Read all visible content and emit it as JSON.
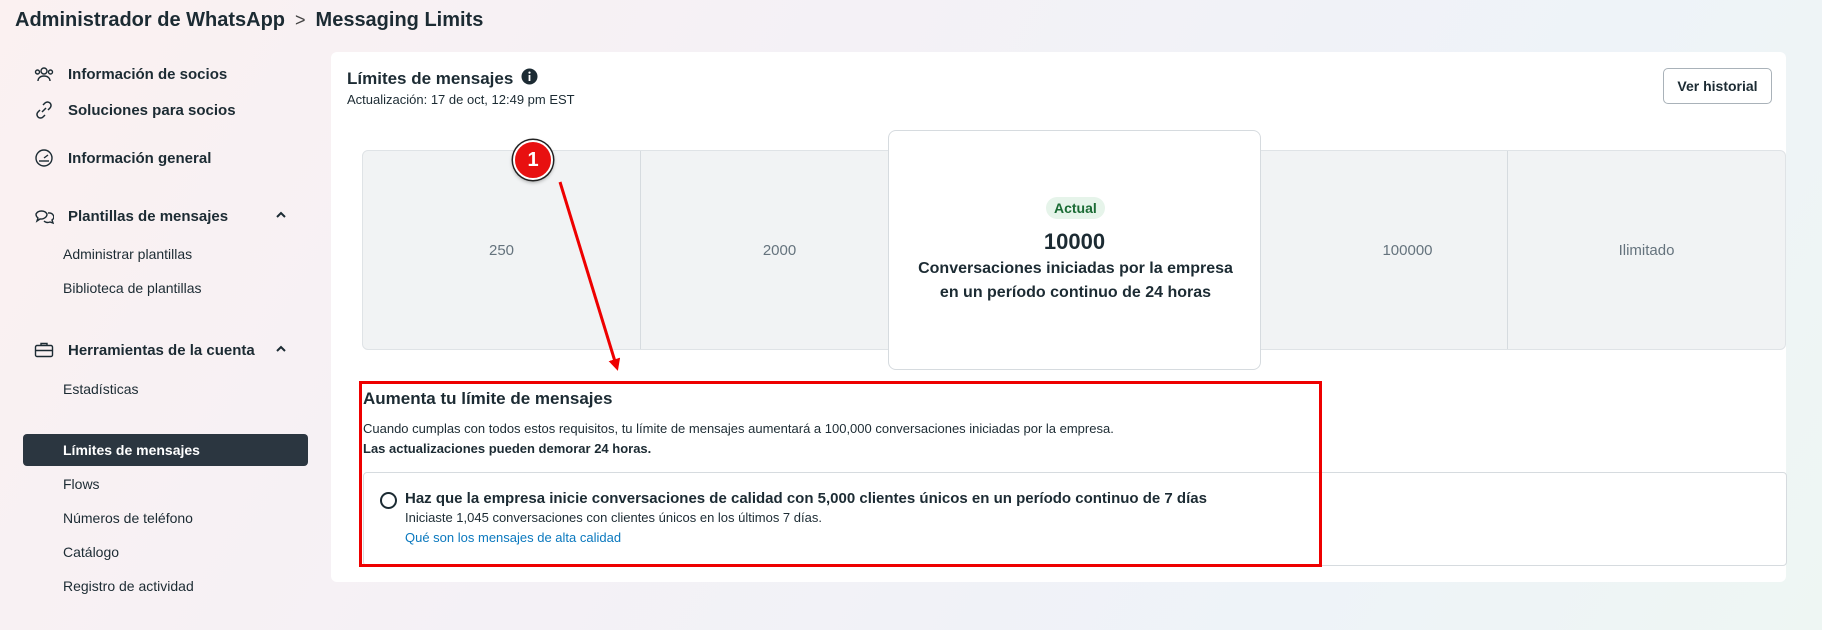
{
  "breadcrumb": {
    "root": "Administrador de WhatsApp",
    "separator": ">",
    "current": "Messaging Limits"
  },
  "sidebar": {
    "items": [
      {
        "label": "Información de socios",
        "icon": "partners-icon"
      },
      {
        "label": "Soluciones para socios",
        "icon": "link-icon"
      },
      {
        "label": "Información general",
        "icon": "gauge-icon"
      },
      {
        "label": "Plantillas de mensajes",
        "icon": "chat-bubbles-icon"
      },
      {
        "label": "Administrar plantillas"
      },
      {
        "label": "Biblioteca de plantillas"
      },
      {
        "label": "Herramientas de la cuenta",
        "icon": "briefcase-icon"
      },
      {
        "label": "Estadísticas"
      },
      {
        "label": "Límites de mensajes",
        "active": true
      },
      {
        "label": "Flows"
      },
      {
        "label": "Números de teléfono"
      },
      {
        "label": "Catálogo"
      },
      {
        "label": "Registro de actividad"
      }
    ]
  },
  "main": {
    "title": "Límites de mensajes",
    "updated": "Actualización: 17 de oct, 12:49 pm EST",
    "history_button": "Ver historial",
    "tiers": [
      {
        "label": "250"
      },
      {
        "label": "2000"
      },
      {
        "label": "100000"
      },
      {
        "label": "Ilimitado"
      }
    ],
    "current_tier": {
      "badge": "Actual",
      "value": "10000",
      "description": "Conversaciones iniciadas por la empresa en un período continuo de 24 horas"
    },
    "increase": {
      "title": "Aumenta tu límite de mensajes",
      "text": "Cuando cumplas con todos estos requisitos, tu límite de mensajes aumentará a 100,000 conversaciones iniciadas por la empresa.",
      "note": "Las actualizaciones pueden demorar 24 horas."
    },
    "requirement": {
      "title": "Haz que la empresa inicie conversaciones de calidad con 5,000 clientes únicos en un período continuo de 7 días",
      "detail": "Iniciaste 1,045 conversaciones con clientes únicos en los últimos 7 días.",
      "link": "Qué son los mensajes de alta calidad"
    }
  },
  "annotation": {
    "badge": "1",
    "color": "#ee0000"
  }
}
